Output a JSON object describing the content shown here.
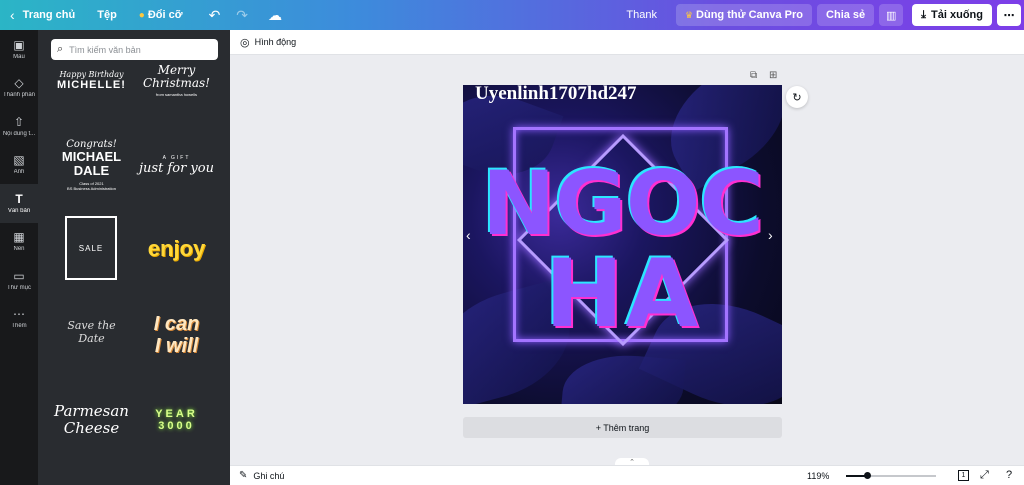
{
  "topbar": {
    "home_label": "Trang chủ",
    "file_label": "Tệp",
    "resize_label": "Đổi cỡ",
    "doc_title": "Thank",
    "try_pro_label": "Dùng thử Canva Pro",
    "share_label": "Chia sẻ",
    "download_label": "Tải xuống"
  },
  "rail": {
    "items": [
      {
        "label": "Mẫu",
        "icon": "templates-icon"
      },
      {
        "label": "Thành phần",
        "icon": "elements-icon"
      },
      {
        "label": "Nội dung t...",
        "icon": "uploads-icon"
      },
      {
        "label": "Ảnh",
        "icon": "photos-icon"
      },
      {
        "label": "Văn bản",
        "icon": "text-icon"
      },
      {
        "label": "Nền",
        "icon": "background-icon"
      },
      {
        "label": "Thư mục",
        "icon": "folder-icon"
      },
      {
        "label": "Thêm",
        "icon": "more-icon"
      }
    ]
  },
  "panel": {
    "search_placeholder": "Tìm kiếm văn bản",
    "tiles": {
      "t1": [
        "Happy Birthday",
        "MICHELLE!"
      ],
      "t2": [
        "Merry",
        "Christmas!",
        "from samantha howells"
      ],
      "t3": [
        "Congrats!",
        "MICHAEL",
        "DALE",
        "Class of 2021",
        "BS Business Administration"
      ],
      "t4": [
        "A GIFT",
        "just for you"
      ],
      "t5": [
        "SALE"
      ],
      "t6": [
        "enjoy"
      ],
      "t7": [
        "Save the Date"
      ],
      "t8": [
        "I can",
        "I will"
      ],
      "t9": [
        "Parmesan",
        "Cheese"
      ],
      "t10": [
        "YEAR",
        "3000"
      ]
    }
  },
  "editor": {
    "animate_label": "Hình động",
    "watermark": "Uyenlinh1707hd247",
    "big_line1": "NGOC",
    "big_line2": "HA",
    "add_page_label": "+ Thêm trang"
  },
  "footer": {
    "notes_label": "Ghi chú",
    "zoom": "119%",
    "page_number": "1"
  }
}
